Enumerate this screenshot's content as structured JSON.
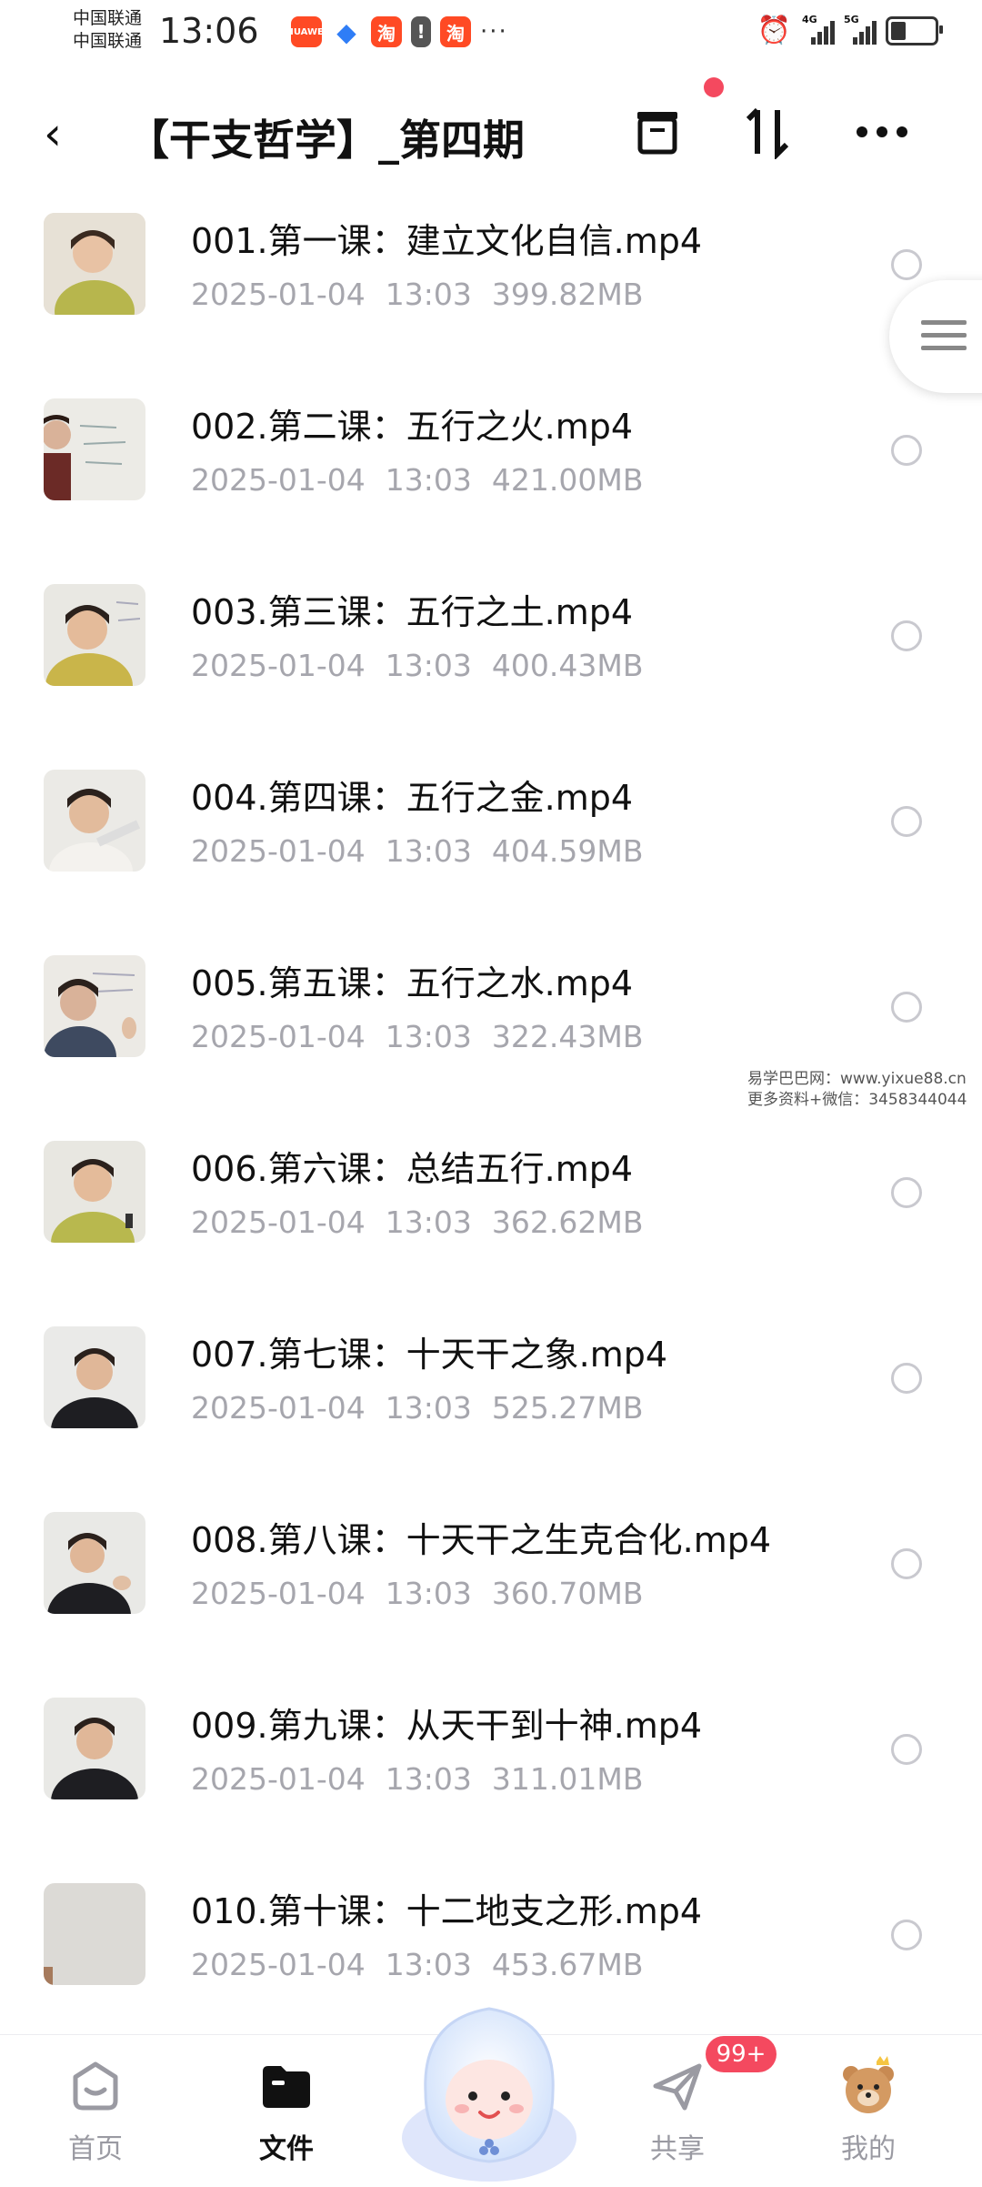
{
  "status_bar": {
    "carrier1": "中国联通",
    "carrier2": "中国联通",
    "time": "13:06",
    "net1": "4G",
    "net2": "5G"
  },
  "header": {
    "title": "【干支哲学】_第四期"
  },
  "files": [
    {
      "name": "001.第一课：建立文化自信.mp4",
      "date": "2025-01-04",
      "time": "13:03",
      "size": "399.82MB"
    },
    {
      "name": "002.第二课：五行之火.mp4",
      "date": "2025-01-04",
      "time": "13:03",
      "size": "421.00MB"
    },
    {
      "name": "003.第三课：五行之土.mp4",
      "date": "2025-01-04",
      "time": "13:03",
      "size": "400.43MB"
    },
    {
      "name": "004.第四课：五行之金.mp4",
      "date": "2025-01-04",
      "time": "13:03",
      "size": "404.59MB"
    },
    {
      "name": "005.第五课：五行之水.mp4",
      "date": "2025-01-04",
      "time": "13:03",
      "size": "322.43MB"
    },
    {
      "name": "006.第六课：总结五行.mp4",
      "date": "2025-01-04",
      "time": "13:03",
      "size": "362.62MB"
    },
    {
      "name": "007.第七课：十天干之象.mp4",
      "date": "2025-01-04",
      "time": "13:03",
      "size": "525.27MB"
    },
    {
      "name": "008.第八课：十天干之生克合化.mp4",
      "date": "2025-01-04",
      "time": "13:03",
      "size": "360.70MB"
    },
    {
      "name": "009.第九课：从天干到十神.mp4",
      "date": "2025-01-04",
      "time": "13:03",
      "size": "311.01MB"
    },
    {
      "name": "010.第十课：十二地支之形.mp4",
      "date": "2025-01-04",
      "time": "13:03",
      "size": "453.67MB"
    }
  ],
  "watermark": {
    "line1": "易学巴巴网：www.yixue88.cn",
    "line2": "更多资料+微信：3458344044"
  },
  "tabs": {
    "home": "首页",
    "files": "文件",
    "share": "共享",
    "mine": "我的",
    "share_badge": "99+"
  },
  "colors": {
    "accent": "#f4495f",
    "meta_gray": "#a6a6ad"
  }
}
